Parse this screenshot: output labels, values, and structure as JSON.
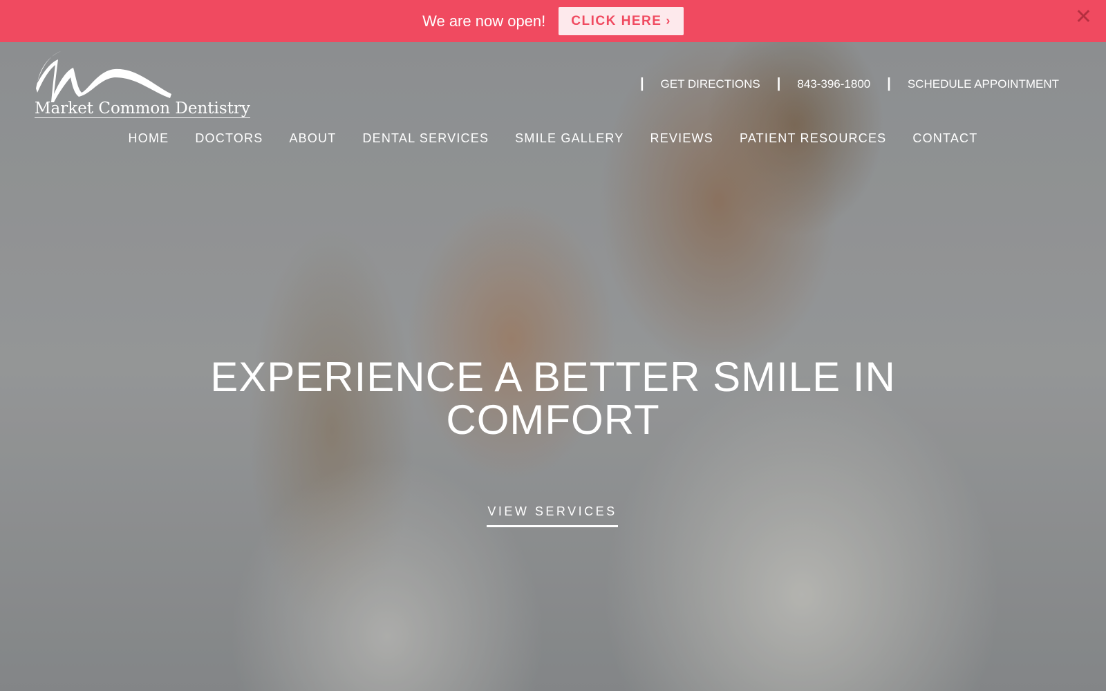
{
  "announcement": {
    "text": "We are now open!",
    "button_label": "CLICK HERE",
    "button_chevron": "›",
    "close_icon": "close-icon",
    "close_glyph": "✕",
    "colors": {
      "bar": "#f04a60",
      "button_bg": "#fde9ec",
      "button_text": "#f04a60"
    }
  },
  "logo": {
    "text": "Market Common Dentistry"
  },
  "utility": {
    "directions": "GET DIRECTIONS",
    "phone": "843-396-1800",
    "schedule": "SCHEDULE APPOINTMENT",
    "separator": "|"
  },
  "nav": {
    "items": [
      "HOME",
      "DOCTORS",
      "ABOUT",
      "DENTAL SERVICES",
      "SMILE GALLERY",
      "REVIEWS",
      "PATIENT RESOURCES",
      "CONTACT"
    ]
  },
  "hero": {
    "headline_line1": "EXPERIENCE A BETTER SMILE IN",
    "headline_line2": "COMFORT",
    "cta_label": "VIEW SERVICES"
  }
}
